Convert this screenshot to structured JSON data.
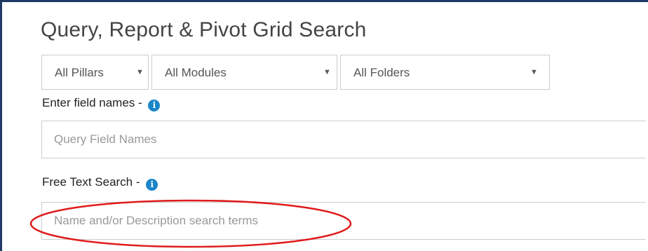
{
  "title": "Query, Report & Pivot Grid Search",
  "filters": {
    "pillars": "All Pillars",
    "modules": "All Modules",
    "folders": "All Folders"
  },
  "field_names": {
    "label": "Enter field names - ",
    "placeholder": "Query Field Names"
  },
  "free_text": {
    "label": "Free Text Search - ",
    "placeholder": "Name and/or Description search terms"
  },
  "icons": {
    "info": "i",
    "dropdown": "▼"
  },
  "colors": {
    "frame": "#1f3864",
    "info_badge": "#1a86c8",
    "highlight_ellipse": "#e01b1b"
  }
}
